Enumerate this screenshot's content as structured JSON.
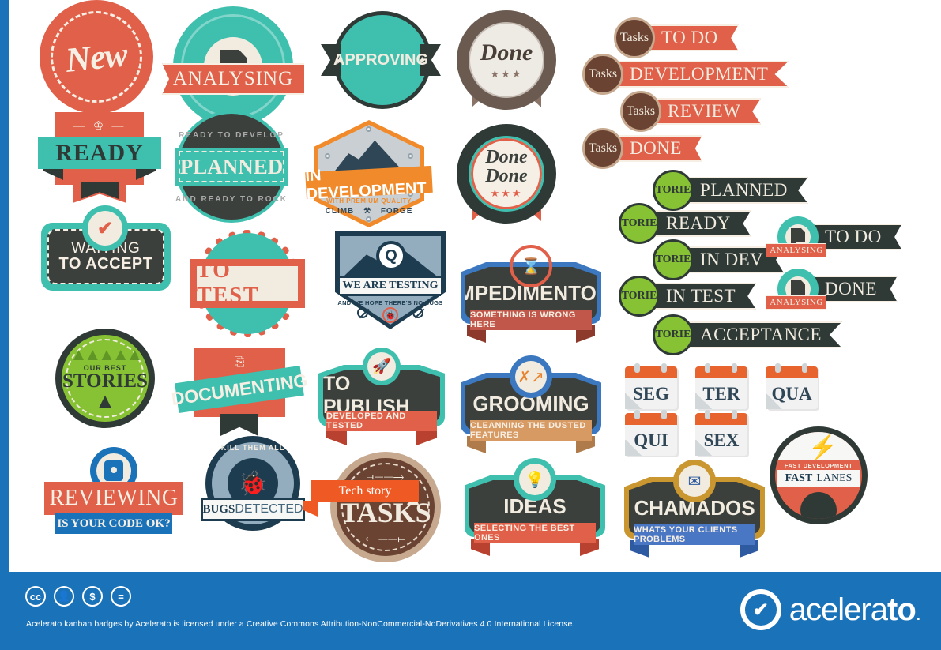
{
  "page": {
    "title": "Acelerato kanban badges",
    "accent_blue": "#1a72b8",
    "accent_red": "#e0604a",
    "accent_teal": "#3fbfae",
    "accent_green": "#86c234",
    "accent_dark": "#3c403c",
    "accent_orange": "#f08a2a",
    "accent_brown": "#6b4332",
    "accent_steel": "#1d3c50"
  },
  "badges": {
    "new": {
      "label": "New"
    },
    "ready": {
      "label": "READY",
      "icon": "crown-icon"
    },
    "waiting": {
      "line1": "WAITING",
      "line2": "TO ACCEPT",
      "icon": "check-icon"
    },
    "our_best_stories": {
      "top": "OUR BEST",
      "label": "STORIES",
      "icon": "rocket-icon"
    },
    "reviewing": {
      "label": "REVIEWING",
      "sub": "IS YOUR CODE OK?",
      "icon": "code-icon"
    },
    "analysing": {
      "label": "ANALYSING",
      "icon": "document-icon"
    },
    "planned": {
      "top": "READY TO DEVELOP",
      "label": "PLANNED",
      "bottom": "AND READY TO ROCK"
    },
    "to_test": {
      "label": "TO TEST"
    },
    "documenting": {
      "label": "DOCUMENTING",
      "icon": "notes-icon"
    },
    "bugs_detected": {
      "top": "KILL THEM ALL",
      "label_bold": "BUGS",
      "label_light": "DETECTED",
      "icon": "bug-icon"
    },
    "approving": {
      "label": "APPROVING",
      "icon": "star-icon"
    },
    "in_development": {
      "label": "IN DEVELOPMENT",
      "sub": "WITH PREMIUM QUALITY",
      "left": "CLIMB",
      "right": "FORGE",
      "icon": "mountain-icon"
    },
    "we_are_testing": {
      "label": "WE ARE TESTING",
      "sub": "AND WE HOPE THERE'S NO BUGS",
      "icon": "magnifier-icon"
    },
    "to_publish": {
      "label": "TO PUBLISH",
      "sub": "DEVELOPED AND TESTED",
      "icon": "rocket-icon"
    },
    "tasks_circle": {
      "ribbon": "Tech story",
      "label": "TASKS",
      "icon": "pine-tree-icon"
    },
    "done": {
      "label": "Done",
      "stars": "★★★"
    },
    "done_done": {
      "line1": "Done",
      "line2": "Done",
      "stars": "★★★"
    },
    "impedimentos": {
      "label": "IMPEDIMENTOS",
      "sub": "SOMETHING IS WRONG HERE",
      "icon": "blocked-icon"
    },
    "grooming": {
      "label": "GROOMING",
      "sub": "CLEANNING THE DUSTED FEATURES",
      "icon": "strategy-icon"
    },
    "ideas": {
      "label": "IDEAS",
      "sub": "SELECTING THE BEST ONES",
      "icon": "lightbulb-head-icon"
    },
    "chamados": {
      "label": "CHAMADOS",
      "sub": "WHATS YOUR CLIENTS PROBLEMS",
      "icon": "email-monitor-icon"
    },
    "fast_lanes": {
      "sub": "FAST DEVELOPMENT",
      "label_bold": "FAST",
      "label_light": "LANES",
      "icon": "bolt-icon"
    }
  },
  "ribbons": {
    "tasks_badge_word": "Tasks",
    "stories_badge_word": "STORIES",
    "analysing_tag": "ANALYSING",
    "tasks": [
      {
        "label": "TO DO"
      },
      {
        "label": "DEVELOPMENT"
      },
      {
        "label": "REVIEW"
      },
      {
        "label": "DONE"
      }
    ],
    "stories": [
      {
        "label": "PLANNED"
      },
      {
        "label": "READY"
      },
      {
        "label": "IN DEV"
      },
      {
        "label": "IN TEST"
      },
      {
        "label": "ACCEPTANCE"
      }
    ],
    "analysing": [
      {
        "label": "TO DO"
      },
      {
        "label": "DONE"
      }
    ]
  },
  "calendars": [
    {
      "label": "SEG"
    },
    {
      "label": "TER"
    },
    {
      "label": "QUA"
    },
    {
      "label": "QUI"
    },
    {
      "label": "SEX"
    }
  ],
  "footer": {
    "license_text": "Acelerato kanban badges by Acelerato is licensed under a Creative Commons Attribution-NonCommercial-NoDerivatives 4.0 International License.",
    "cc_icons": [
      "cc",
      "by",
      "nc",
      "nd"
    ],
    "logo_a": "acelera",
    "logo_b": "to",
    "logo_dot": "."
  }
}
